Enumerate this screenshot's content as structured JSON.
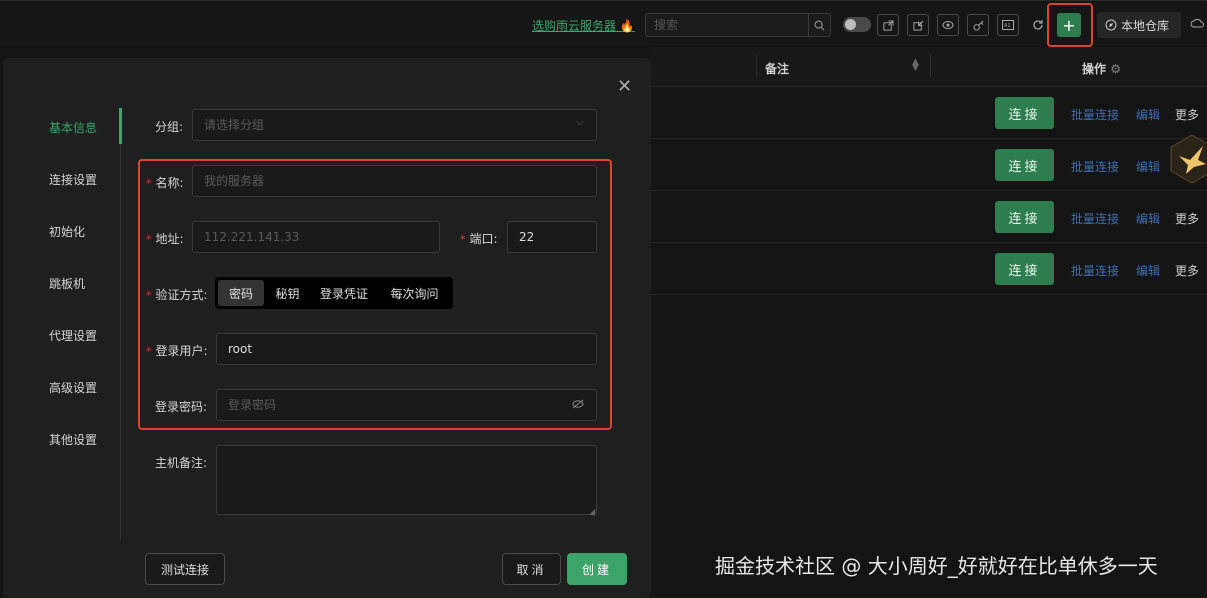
{
  "topbar": {
    "promo_link": "选购雨云服务器",
    "promo_icon": "fire-icon",
    "search_placeholder": "搜索",
    "local_repo_label": "本地仓库"
  },
  "table": {
    "header_note": "备注",
    "header_actions": "操作",
    "rows": [
      {
        "connect": "连接",
        "batch": "批量连接",
        "edit": "编辑",
        "more": "更多"
      },
      {
        "connect": "连接",
        "batch": "批量连接",
        "edit": "编辑",
        "more": ""
      },
      {
        "connect": "连接",
        "batch": "批量连接",
        "edit": "编辑",
        "more": "更多"
      },
      {
        "connect": "连接",
        "batch": "批量连接",
        "edit": "编辑",
        "more": "更多"
      }
    ]
  },
  "modal": {
    "sidebar": [
      "基本信息",
      "连接设置",
      "初始化",
      "跳板机",
      "代理设置",
      "高级设置",
      "其他设置"
    ],
    "group_label": "分组:",
    "group_placeholder": "请选择分组",
    "name_label": "名称:",
    "name_placeholder": "我的服务器",
    "address_label": "地址:",
    "address_placeholder": "112.221.141.33",
    "port_label": "端口:",
    "port_value": "22",
    "auth_label": "验证方式:",
    "auth_options": [
      "密码",
      "秘钥",
      "登录凭证",
      "每次询问"
    ],
    "auth_selected": "密码",
    "user_label": "登录用户:",
    "user_value": "root",
    "password_label": "登录密码:",
    "password_placeholder": "登录密码",
    "note_label": "主机备注:",
    "test_button": "测试连接",
    "cancel_button": "取消",
    "create_button": "创建"
  },
  "watermark": "掘金技术社区 @ 大小周好_好就好在比单休多一天",
  "colors": {
    "accent_green": "#3ca468",
    "highlight_red": "#d9452f",
    "link_blue": "#3f6fb0"
  }
}
